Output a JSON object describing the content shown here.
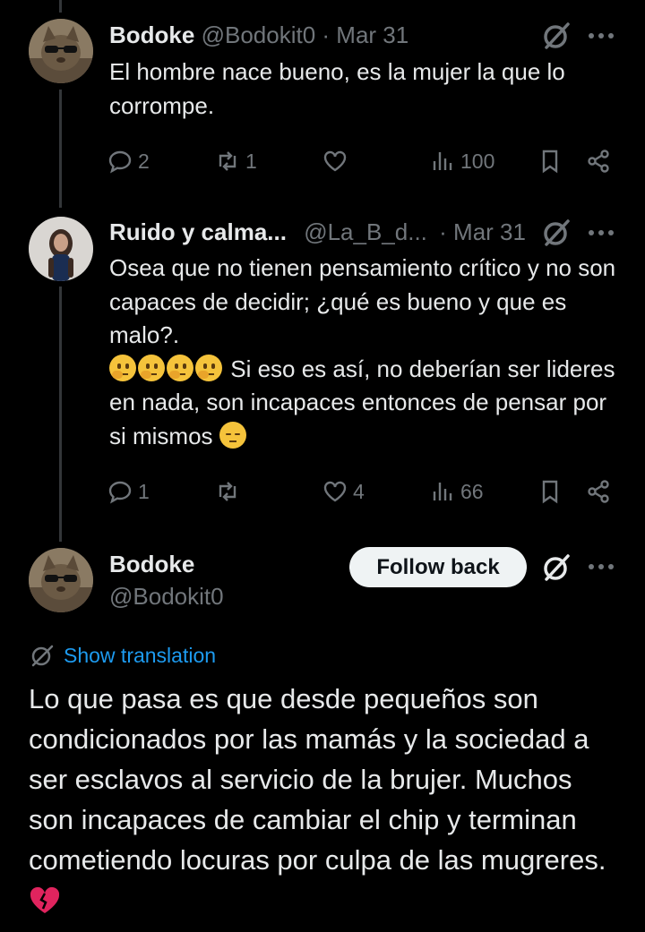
{
  "tweets": [
    {
      "name": "Bodoke",
      "handle": "@Bodokit0",
      "separator": "·",
      "date": "Mar 31",
      "text": "El hombre nace bueno, es la mujer la que lo corrompe.",
      "replies": "2",
      "reposts": "1",
      "likes": "",
      "views": "100",
      "avatar": "cat-with-sunglasses-avatar"
    },
    {
      "name": "Ruido y calma...",
      "handle": "@La_B_d...",
      "separator": "·",
      "date": "Mar 31",
      "text_line1": "Osea que no tienen pensamiento crítico y no son capaces de decidir; ¿qué es bueno y que es malo?.",
      "text_line2": "Si eso es así, no deberían ser lideres en nada, son incapaces entonces de pensar por si mismos",
      "emojis_line2": [
        "thinking-face",
        "thinking-face",
        "thinking-face",
        "thinking-face"
      ],
      "emoji_end": "pensive-face",
      "replies": "1",
      "reposts": "",
      "likes": "4",
      "views": "66",
      "avatar": "woman-portrait-avatar"
    }
  ],
  "main_tweet": {
    "name": "Bodoke",
    "handle": "@Bodokit0",
    "follow_label": "Follow back",
    "translate_label": "Show translation",
    "text": "Lo que pasa es que desde pequeños son condicionados por las mamás y la sociedad a ser esclavos al servicio de la brujer. Muchos son incapaces de cambiar el chip y terminan cometiendo locuras por culpa de las mugreres.",
    "end_emoji": "broken-heart",
    "avatar": "cat-with-sunglasses-avatar"
  },
  "colors": {
    "background": "#000000",
    "text": "#e7e9ea",
    "secondary": "#71767b",
    "link": "#1d9bf0",
    "button_bg": "#eff3f4",
    "broken_heart": "#e0245e"
  },
  "icons": [
    "reply-icon",
    "repost-icon",
    "like-icon",
    "views-icon",
    "bookmark-icon",
    "share-icon",
    "grok-icon",
    "more-icon",
    "globe-icon"
  ]
}
